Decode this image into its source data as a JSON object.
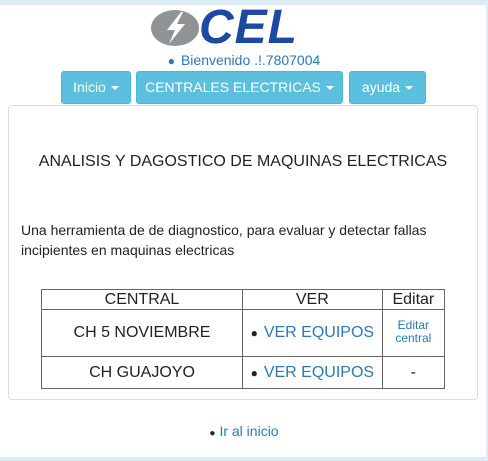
{
  "header": {
    "logo_text": "CEL",
    "welcome_text": "Bienvenido .!.7807004"
  },
  "nav": {
    "inicio_label": "Inicio",
    "centrales_label": "CENTRALES ELECTRICAS",
    "ayuda_label": "ayuda"
  },
  "main": {
    "title": "ANALISIS Y DAGOSTICO DE MAQUINAS ELECTRICAS",
    "description": "Una herramienta de de diagnostico, para evaluar y detectar fallas incipientes en maquinas electricas",
    "table": {
      "headers": [
        "CENTRAL",
        "VER",
        "Editar"
      ],
      "rows": [
        {
          "central": "CH 5 NOVIEMBRE",
          "ver": "VER EQUIPOS",
          "editar": "Editar central"
        },
        {
          "central": "CH GUAJOYO",
          "ver": "VER EQUIPOS",
          "editar": "-"
        }
      ]
    }
  },
  "footer": {
    "home_link": "Ir al inicio"
  },
  "colors": {
    "nav_button": "#5bc0de",
    "link": "#2a79b3",
    "logo_text": "#1c4aa0",
    "background": "#dcedf5"
  }
}
